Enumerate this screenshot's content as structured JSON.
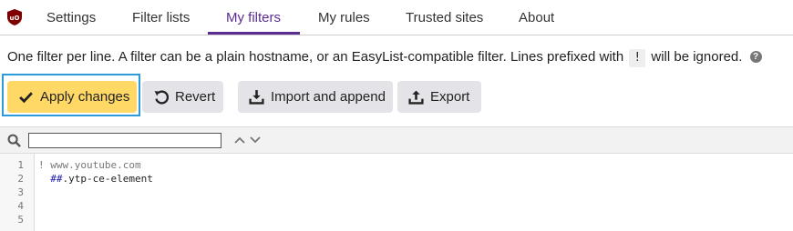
{
  "tabs": [
    {
      "label": "Settings"
    },
    {
      "label": "Filter lists"
    },
    {
      "label": "My filters"
    },
    {
      "label": "My rules"
    },
    {
      "label": "Trusted sites"
    },
    {
      "label": "About"
    }
  ],
  "active_tab": "My filters",
  "description": {
    "before": "One filter per line. A filter can be a plain hostname, or an EasyList-compatible filter. Lines prefixed with",
    "marker": "!",
    "after": "will be ignored.",
    "help": "?"
  },
  "toolbar": {
    "apply_label": "Apply changes",
    "revert_label": "Revert",
    "import_label": "Import and append",
    "export_label": "Export"
  },
  "search": {
    "value": "",
    "placeholder": ""
  },
  "editor": {
    "line_numbers": [
      "1",
      "2",
      "3",
      "4",
      "5"
    ],
    "lines": [
      {
        "comment": "! www.youtube.com"
      },
      {
        "prefix": "  ##",
        "rest": ".ytp-ce-element"
      }
    ]
  },
  "colors": {
    "accent": "#5c2d91",
    "apply_button": "#ffd866",
    "button": "#e4e4e8",
    "focus": "#2c9bd9"
  }
}
